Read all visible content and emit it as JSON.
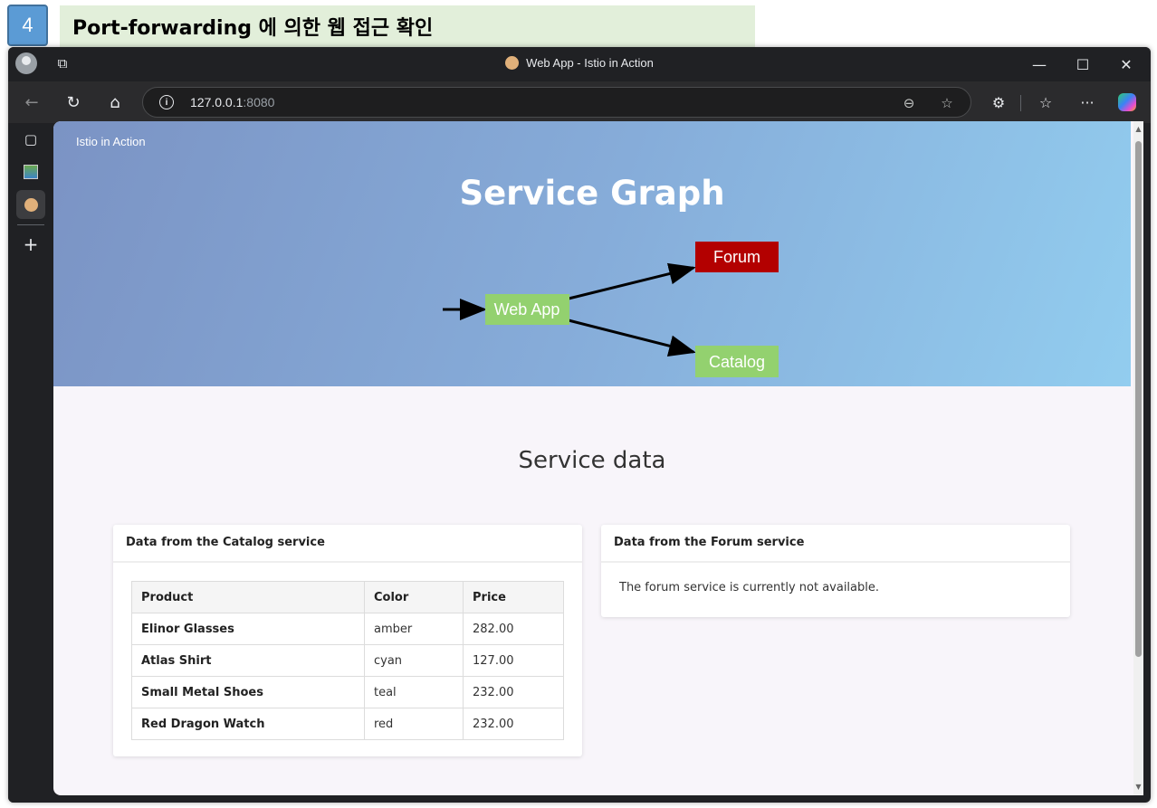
{
  "slide": {
    "step_number": "4",
    "title": "Port-forwarding 에 의한 웹 접근 확인"
  },
  "browser": {
    "window_title": "Web App - Istio in Action",
    "url_host": "127.0.0.1",
    "url_port": ":8080"
  },
  "page": {
    "brand": "Istio in Action",
    "hero_title": "Service Graph",
    "graph_nodes": {
      "web_app": "Web App",
      "forum": "Forum",
      "catalog": "Catalog"
    },
    "colors": {
      "web_app_node": "#93d16f",
      "forum_node": "#b30000",
      "catalog_node": "#93d16f"
    },
    "section_title": "Service data",
    "catalog_card": {
      "title": "Data from the Catalog service",
      "headers": [
        "Product",
        "Color",
        "Price"
      ],
      "rows": [
        [
          "Elinor Glasses",
          "amber",
          "282.00"
        ],
        [
          "Atlas Shirt",
          "cyan",
          "127.00"
        ],
        [
          "Small Metal Shoes",
          "teal",
          "232.00"
        ],
        [
          "Red Dragon Watch",
          "red",
          "232.00"
        ]
      ]
    },
    "forum_card": {
      "title": "Data from the Forum service",
      "message": "The forum service is currently not available."
    }
  }
}
